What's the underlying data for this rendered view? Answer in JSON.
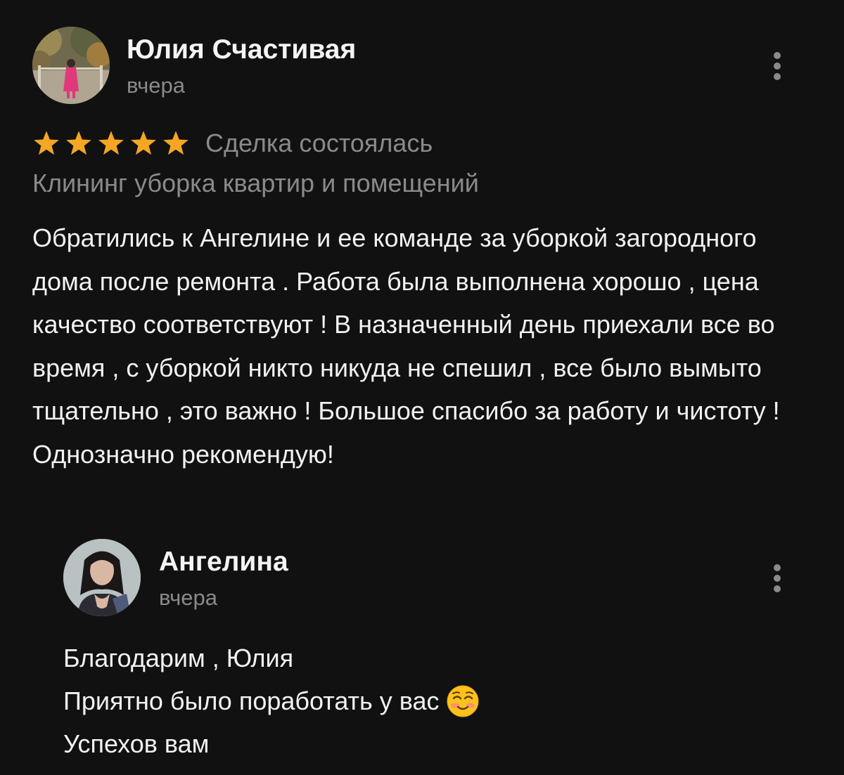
{
  "review": {
    "author": {
      "name": "Юлия Счастивая",
      "date": "вчера",
      "avatar": "photo-woman-pink-dress-park-bridge"
    },
    "rating": 5,
    "max_rating": 5,
    "star_color": "#f5a623",
    "deal_status": "Сделка состоялась",
    "category": "Клининг уборка квартир и помещений",
    "text": "Обратились к Ангелине и ее команде за уборкой загородного дома после ремонта . Работа была выполнена хорошо , цена качество соответствуют ! В назначенный день приехали все во время , с уборкой никто никуда не спешил , все было вымыто тщательно , это важно ! Большое спасибо за работу и чистоту ! Однозначно рекомендую!",
    "more_icon": "more-vertical-icon"
  },
  "reply": {
    "author": {
      "name": "Ангелина",
      "date": "вчера",
      "avatar": "photo-woman-dark-hair"
    },
    "lines": [
      "Благодарим , Юлия",
      "Приятно было поработать у вас",
      "Успехов вам"
    ],
    "emoji": "smiling-face-icon",
    "more_icon": "more-vertical-icon"
  },
  "colors": {
    "background": "#111111",
    "text_primary": "#f2f2f2",
    "text_secondary": "#8a8a8a",
    "star": "#f5a623"
  }
}
